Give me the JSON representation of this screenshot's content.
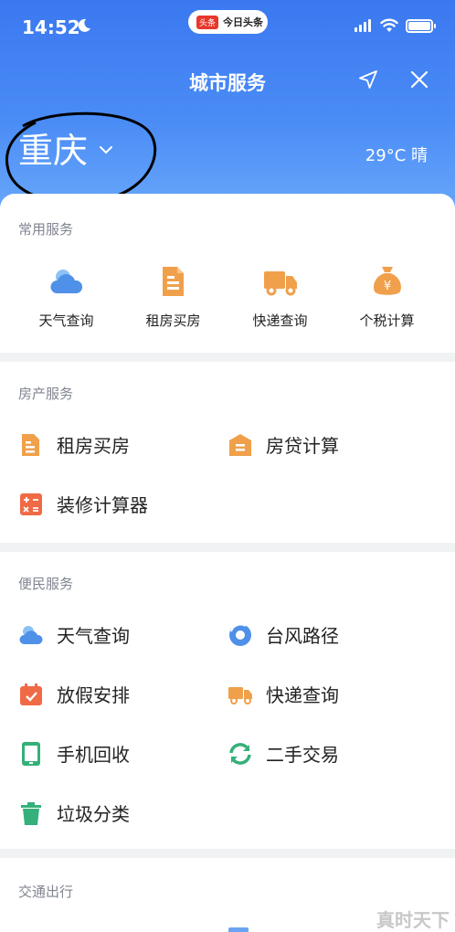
{
  "status_bar": {
    "time": "14:52",
    "app_badge_logo": "头条",
    "app_badge_name": "今日头条"
  },
  "header": {
    "title": "城市服务",
    "city": "重庆",
    "weather": "29°C 晴"
  },
  "icons": {
    "location": "location-arrow-icon",
    "close": "close-icon",
    "chevron": "chevron-down-icon",
    "weather": "cloud-icon",
    "rent": "document-icon",
    "express": "truck-icon",
    "tax": "money-bag-icon",
    "loan": "house-icon",
    "calc": "calculator-icon",
    "typhoon": "typhoon-icon",
    "holiday": "calendar-icon",
    "phone": "phone-icon",
    "trade": "recycle-icon",
    "trash": "trash-icon"
  },
  "colors": {
    "header_blue": "#3b78f0",
    "orange": "#f0a04b",
    "red": "#ef6a45",
    "green": "#35b07a",
    "blue": "#4f90e8"
  },
  "common_services": {
    "title": "常用服务",
    "items": [
      {
        "label": "天气查询"
      },
      {
        "label": "租房买房"
      },
      {
        "label": "快递查询"
      },
      {
        "label": "个税计算"
      }
    ]
  },
  "property_services": {
    "title": "房产服务",
    "items": [
      {
        "label": "租房买房"
      },
      {
        "label": "房贷计算"
      },
      {
        "label": "装修计算器"
      }
    ]
  },
  "convenience_services": {
    "title": "便民服务",
    "items": [
      {
        "label": "天气查询"
      },
      {
        "label": "台风路径"
      },
      {
        "label": "放假安排"
      },
      {
        "label": "快递查询"
      },
      {
        "label": "手机回收"
      },
      {
        "label": "二手交易"
      },
      {
        "label": "垃圾分类"
      }
    ]
  },
  "transport": {
    "title": "交通出行"
  },
  "watermark": "真时天下"
}
